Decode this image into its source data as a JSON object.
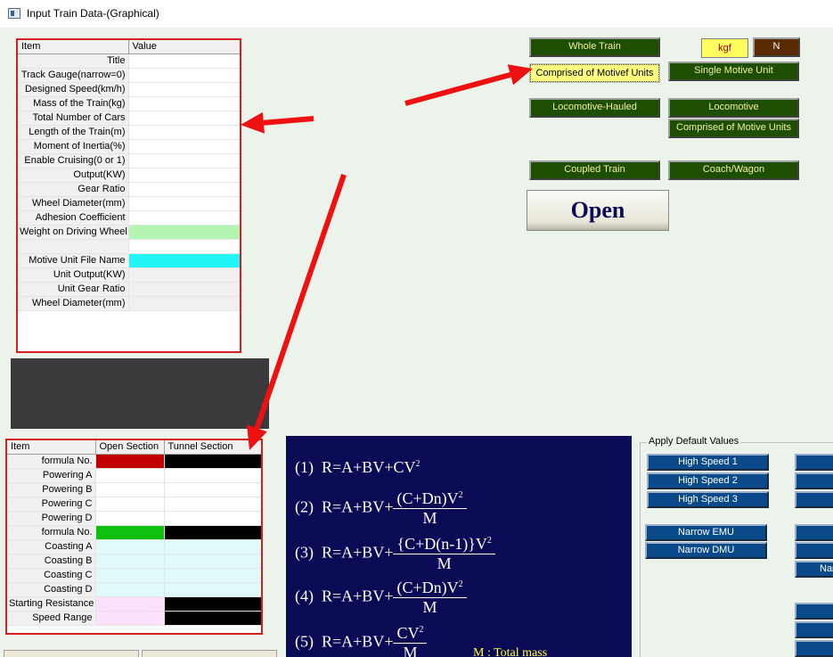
{
  "window": {
    "title": "Input Train Data-(Graphical)"
  },
  "train_grid": {
    "col_item": "Item",
    "col_value": "Value",
    "rows": [
      {
        "label": "Title",
        "color": "#ffffff"
      },
      {
        "label": "Track Gauge(narrow=0)",
        "color": "#ffffff"
      },
      {
        "label": "Designed Speed(km/h)",
        "color": "#ffffff"
      },
      {
        "label": "Mass of the Train(kg)",
        "color": "#ffffff"
      },
      {
        "label": "Total Number of Cars",
        "color": "#ffffff"
      },
      {
        "label": "Length of the Train(m)",
        "color": "#ffffff"
      },
      {
        "label": "Moment of Inertia(%)",
        "color": "#ffffff"
      },
      {
        "label": "Enable Cruising(0 or  1)",
        "color": "#ffffff"
      },
      {
        "label": "Output(KW)",
        "color": "#ffffff"
      },
      {
        "label": "Gear Ratio",
        "color": "#ffffff"
      },
      {
        "label": "Wheel Diameter(mm)",
        "color": "#ffffff"
      },
      {
        "label": "Adhesion Coefficient",
        "color": "#ffffff"
      },
      {
        "label": "Weight on Driving Wheel",
        "color": "#b4f5b4"
      },
      {
        "label": "",
        "color": "#ffffff"
      },
      {
        "label": "Motive Unit File Name",
        "color": "#22f5f5"
      },
      {
        "label": "Unit Output(KW)",
        "color": "#f0f0f0"
      },
      {
        "label": "Unit Gear Ratio",
        "color": "#f0f0f0"
      },
      {
        "label": "Wheel Diameter(mm)",
        "color": "#f0f0f0"
      }
    ]
  },
  "resistance_grid": {
    "col_item": "Item",
    "col_open": "Open Section",
    "col_tunnel": "Tunnel Section",
    "rows": [
      {
        "label": "formula No.",
        "open": "#c00000",
        "tunnel": "#000000"
      },
      {
        "label": "Powering A",
        "open": "#ffffff",
        "tunnel": "#ffffff"
      },
      {
        "label": "Powering B",
        "open": "#ffffff",
        "tunnel": "#ffffff"
      },
      {
        "label": "Powering C",
        "open": "#ffffff",
        "tunnel": "#ffffff"
      },
      {
        "label": "Powering D",
        "open": "#ffffff",
        "tunnel": "#ffffff"
      },
      {
        "label": "formula No.",
        "open": "#10c010",
        "tunnel": "#000000"
      },
      {
        "label": "Coasting A",
        "open": "#e0fafa",
        "tunnel": "#e0fafa"
      },
      {
        "label": "Coasting B",
        "open": "#e0fafa",
        "tunnel": "#e0fafa"
      },
      {
        "label": "Coasting C",
        "open": "#e0fafa",
        "tunnel": "#e0fafa"
      },
      {
        "label": "Coasting D",
        "open": "#e0fafa",
        "tunnel": "#e0fafa"
      },
      {
        "label": "Starting Resistance",
        "open": "#fce0fc",
        "tunnel": "#000000"
      },
      {
        "label": "Speed Range",
        "open": "#fce0fc",
        "tunnel": "#000000"
      }
    ]
  },
  "buttons": {
    "whole_train": "Whole Train",
    "kgf": "kgf",
    "n": "N",
    "comprised_motive": "Comprised of Motivef Units",
    "single_motive": "Single Motive Unit",
    "loco_hauled": "Locomotive-Hauled",
    "locomotive": "Locomotive",
    "comprised_motive2": "Comprised of Motive Units",
    "coupled_train": "Coupled Train",
    "coach_wagon": "Coach/Wagon",
    "open": "Open"
  },
  "defaults": {
    "legend": "Apply Default Values",
    "high_speed_1": "High Speed 1",
    "high_speed_2": "High Speed 2",
    "high_speed_3": "High Speed 3",
    "narrow_emu": "Narrow EMU",
    "narrow_dmu": "Narrow DMU",
    "right_partial": "Nar"
  },
  "formulas": {
    "f1_num": "(1)",
    "f1": "R=A+BV+CV",
    "f2_num": "(2)",
    "f2_base": "R=A+BV+",
    "f2_top": "(C+Dn)V",
    "f2_bottom": "M",
    "f3_num": "(3)",
    "f3_base": "R=A+BV+",
    "f3_top": "{C+D(n-1)}V",
    "f3_bottom": "M",
    "f4_num": "(4)",
    "f4_base": "R=A+BV+",
    "f4_top": "(C+Dn)V",
    "f4_bottom": "M",
    "f5_num": "(5)",
    "f5_base": "R=A+BV+",
    "f5_top": "CV",
    "f5_bottom": "M",
    "exp": "2",
    "note": "M : Total mass"
  },
  "colors": {
    "arrow": "#ee1111",
    "grid_border": "#d42020"
  }
}
